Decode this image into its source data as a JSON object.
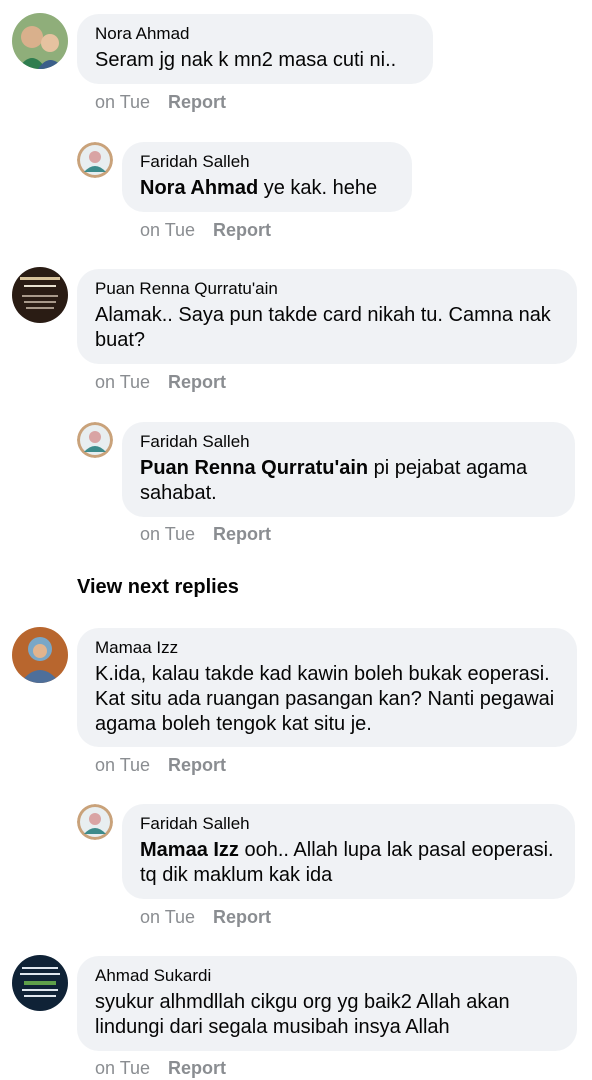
{
  "comments": [
    {
      "author": "Nora Ahmad",
      "text": "Seram jg nak k mn2 masa cuti ni..",
      "time": "on Tue",
      "report": "Report"
    },
    {
      "author": "Faridah Salleh",
      "mention": "Nora Ahmad",
      "text": " ye kak. hehe",
      "time": "on Tue",
      "report": "Report"
    },
    {
      "author": "Puan Renna Qurratu'ain",
      "text": "Alamak.. Saya pun takde card nikah tu. Camna nak buat?",
      "time": "on Tue",
      "report": "Report"
    },
    {
      "author": "Faridah Salleh",
      "mention": "Puan Renna Qurratu'ain",
      "text": " pi pejabat agama sahabat.",
      "time": "on Tue",
      "report": "Report"
    },
    {
      "author": "Mamaa Izz",
      "text": "K.ida, kalau takde kad kawin boleh bukak eoperasi. Kat situ ada ruangan pasangan kan? Nanti pegawai agama boleh tengok kat situ je.",
      "time": "on Tue",
      "report": "Report"
    },
    {
      "author": "Faridah Salleh",
      "mention": "Mamaa Izz",
      "text": " ooh.. Allah lupa lak pasal eoperasi. tq dik maklum kak ida",
      "time": "on Tue",
      "report": "Report"
    },
    {
      "author": "Ahmad Sukardi",
      "text": "syukur alhmdllah cikgu org yg baik2 Allah akan lindungi dari segala musibah insya Allah",
      "time": "on Tue",
      "report": "Report"
    }
  ],
  "view_next_replies": "View next replies"
}
